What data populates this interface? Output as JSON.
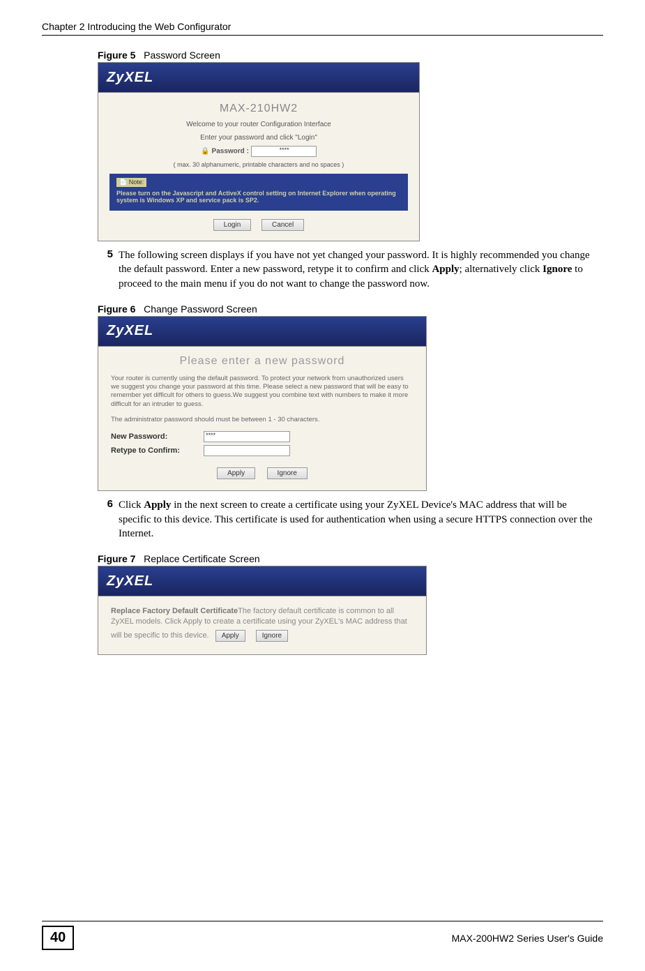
{
  "header": {
    "chapter": "Chapter 2 Introducing the Web Configurator"
  },
  "fig5": {
    "caption_label": "Figure 5",
    "caption_title": "Password Screen",
    "logo": "ZyXEL",
    "model": "MAX-210HW2",
    "welcome": "Welcome to your router Configuration Interface",
    "instruct": "Enter your password and click \"Login\"",
    "pw_label": "Password :",
    "pw_value": "****",
    "hint": "( max. 30 alphanumeric, printable characters and no spaces )",
    "note_title": "Note:",
    "note_body": "Please turn on the Javascript and ActiveX control setting on Internet Explorer when operating system is Windows XP and service pack is SP2.",
    "login_btn": "Login",
    "cancel_btn": "Cancel"
  },
  "step5": {
    "num": "5",
    "text_before": "The following screen displays if you have not yet changed your password. It is highly recommended you change the default password. Enter a new password, retype it to confirm and click ",
    "apply": "Apply",
    "text_mid": "; alternatively click ",
    "ignore": "Ignore",
    "text_after": " to proceed to the main menu if you do not want to change the password now."
  },
  "fig6": {
    "caption_label": "Figure 6",
    "caption_title": "Change Password Screen",
    "logo": "ZyXEL",
    "subtitle": "Please enter a new password",
    "blurb1": "Your router is currently using the default password. To protect your network from unauthorized users we suggest you change your password at this time. Please select a new password that will be easy to remember yet difficult for others to guess.We suggest you combine text with numbers to make it more difficult for an intruder to guess.",
    "blurb2": "The administrator password should must be between 1 - 30 characters.",
    "new_pw_label": "New Password:",
    "new_pw_value": "****",
    "retype_label": "Retype to Confirm:",
    "apply_btn": "Apply",
    "ignore_btn": "Ignore"
  },
  "step6": {
    "num": "6",
    "text_before": "Click ",
    "apply": "Apply",
    "text_after": " in the next screen to create a certificate using your ZyXEL Device's MAC address that will be specific to this device. This certificate is used for authentication when using a secure HTTPS connection over the Internet."
  },
  "fig7": {
    "caption_label": "Figure 7",
    "caption_title": "Replace Certificate Screen",
    "logo": "ZyXEL",
    "body_bold": "Replace Factory Default Certificate",
    "body_rest": "The factory default certificate is common to all ZyXEL models. Click Apply to create a certificate using your ZyXEL's MAC address that will be specific to this device.",
    "apply_btn": "Apply",
    "ignore_btn": "Ignore"
  },
  "footer": {
    "page_num": "40",
    "guide": "MAX-200HW2 Series User's Guide"
  }
}
